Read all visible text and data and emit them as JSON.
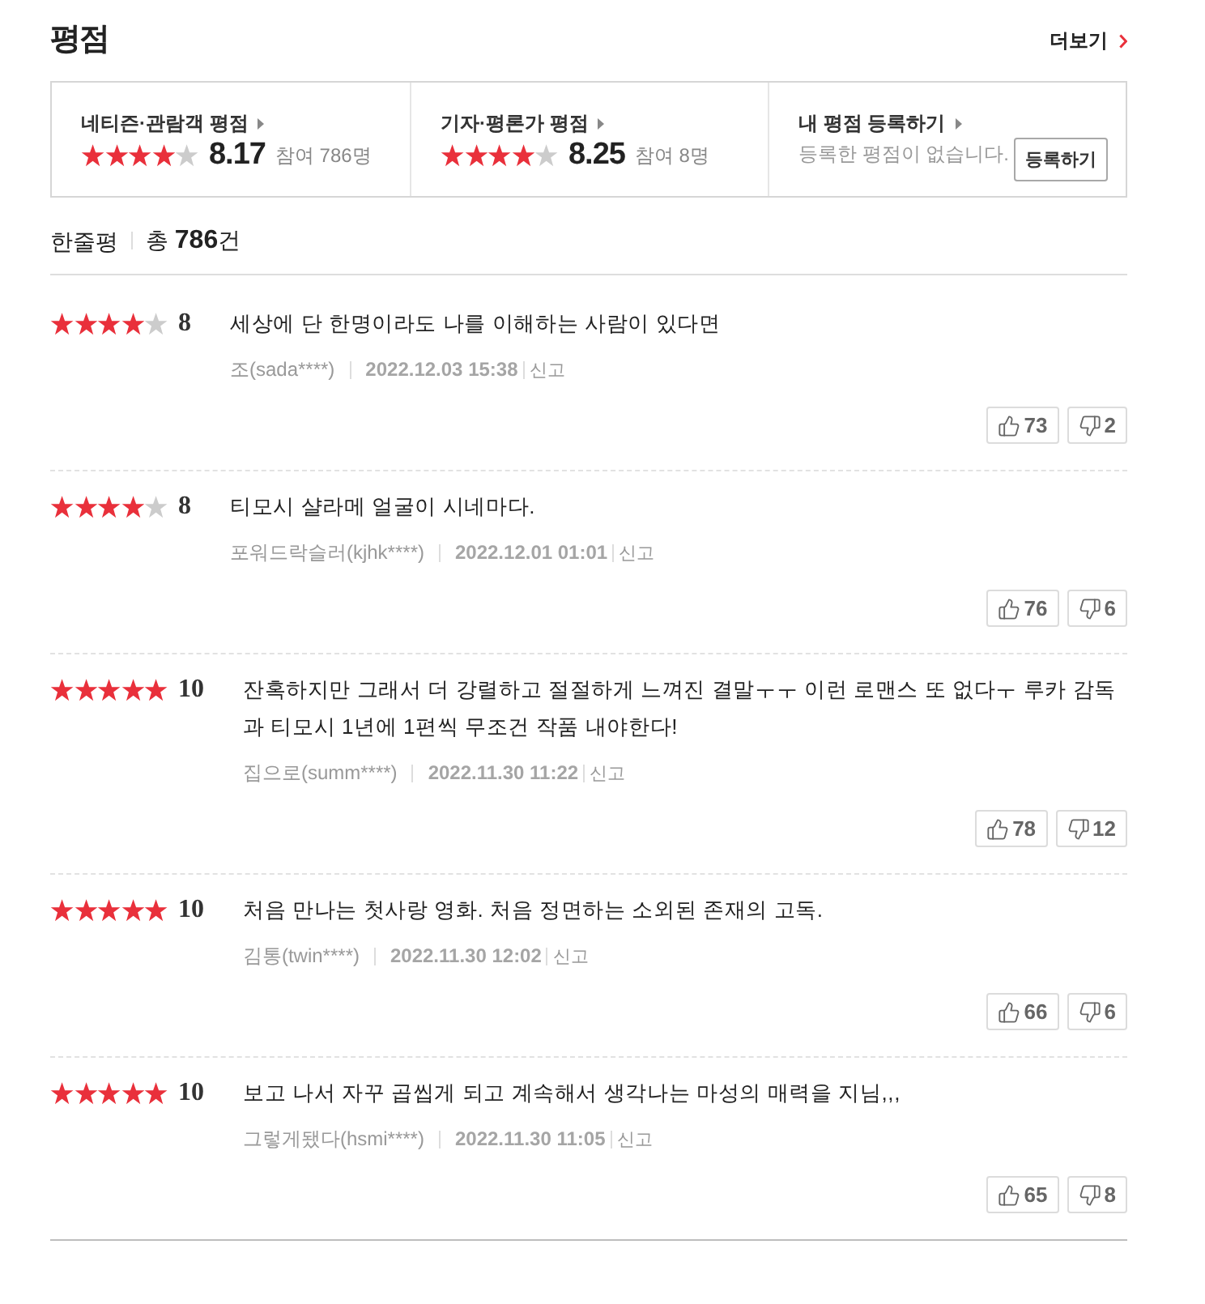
{
  "header": {
    "title": "평점",
    "more_link": "더보기"
  },
  "summary": [
    {
      "kind": "rating",
      "label": "네티즌·관람객 평점",
      "stars": 4,
      "score": "8.17",
      "participants": "참여 786명"
    },
    {
      "kind": "rating",
      "label": "기자·평론가 평점",
      "stars": 4,
      "score": "8.25",
      "participants": "참여 8명"
    },
    {
      "kind": "register",
      "label": "내 평점 등록하기",
      "message": "등록한 평점이 없습니다.",
      "button": "등록하기"
    }
  ],
  "reviews_header": {
    "title": "한줄평",
    "count": "총 **786**건"
  },
  "reviews": [
    {
      "stars": 4,
      "score": "8",
      "text": "세상에 단 한명이라도 나를 이해하는 사람이 있다면",
      "author": "조(sada****)",
      "date": "2022.12.03 15:38",
      "report": "신고",
      "likes": "73",
      "dislikes": "2"
    },
    {
      "stars": 4,
      "score": "8",
      "text": "티모시 샬라메 얼굴이 시네마다.",
      "author": "포워드락슬러(kjhk****)",
      "date": "2022.12.01 01:01",
      "report": "신고",
      "likes": "76",
      "dislikes": "6"
    },
    {
      "stars": 5,
      "score": "10",
      "text": "잔혹하지만 그래서 더 강렬하고 절절하게 느껴진 결말ㅜㅜ 이런 로맨스 또 없다ㅜ 루카 감독과 티모시 1년에 1편씩 무조건 작품 내야한다!",
      "author": "집으로(summ****)",
      "date": "2022.11.30 11:22",
      "report": "신고",
      "likes": "78",
      "dislikes": "12"
    },
    {
      "stars": 5,
      "score": "10",
      "text": "처음 만나는 첫사랑 영화. 처음 정면하는 소외된 존재의 고독.",
      "author": "김통(twin****)",
      "date": "2022.11.30 12:02",
      "report": "신고",
      "likes": "66",
      "dislikes": "6"
    },
    {
      "stars": 5,
      "score": "10",
      "text": "보고 나서 자꾸 곱씹게 되고 계속해서 생각나는 마성의 매력을 지님,,,",
      "author": "그렇게됐다(hsmi****)",
      "date": "2022.11.30 11:05",
      "report": "신고",
      "likes": "65",
      "dislikes": "8"
    }
  ]
}
